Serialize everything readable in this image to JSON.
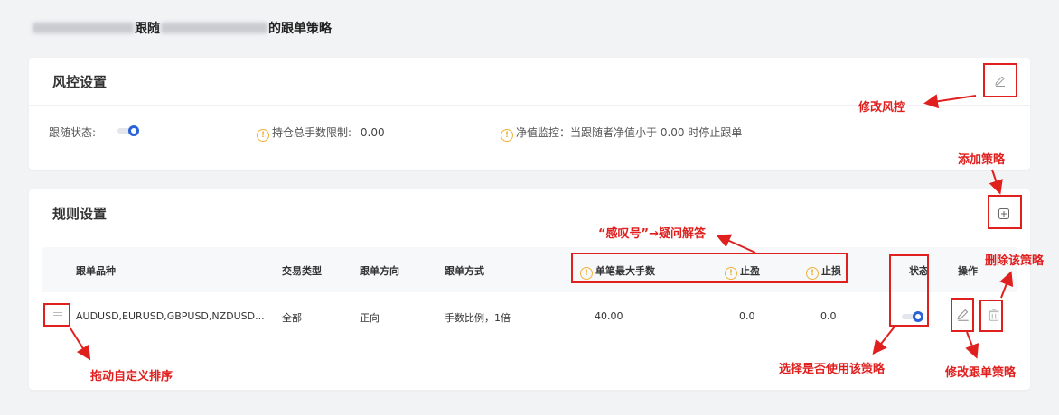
{
  "page": {
    "title_part1": "跟随",
    "title_part2": "的跟单策略"
  },
  "risk": {
    "title": "风控设置",
    "follow_status_label": "跟随状态:",
    "position_limit_label": "持仓总手数限制:",
    "position_limit_value": "0.00",
    "equity_monitor_text": "净值监控：当跟随者净值小于 0.00 时停止跟单",
    "follow_status_on": true
  },
  "rules": {
    "title": "规则设置",
    "columns": [
      "跟单品种",
      "交易类型",
      "跟单方向",
      "跟单方式",
      "单笔最大手数",
      "止盈",
      "止损",
      "状态",
      "操作"
    ],
    "rows": [
      {
        "symbols": "AUDUSD,EURUSD,GBPUSD,NZDUSD...",
        "trade_type": "全部",
        "direction": "正向",
        "mode": "手数比例，1倍",
        "max_lot": "40.00",
        "take_profit": "0.0",
        "stop_loss": "0.0",
        "enabled": true
      }
    ]
  },
  "annotations": {
    "edit_risk": "修改风控",
    "add_strategy": "添加策略",
    "exclaim_help": "“感叹号”→疑问解答",
    "delete_strategy": "删除该策略",
    "toggle_use": "选择是否使用该策略",
    "edit_strategy": "修改跟单策略",
    "drag_sort": "拖动自定义排序"
  },
  "colors": {
    "accent": "#2a62d8",
    "annotation_red": "#e0201f",
    "info_orange": "#f0b23a"
  }
}
